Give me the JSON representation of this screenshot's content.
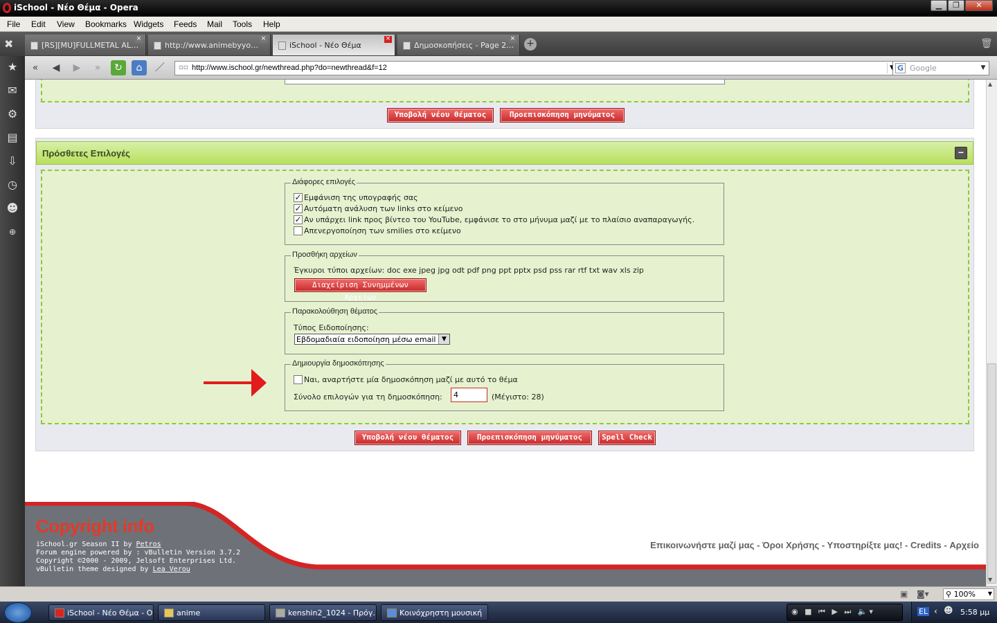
{
  "window": {
    "title": "iSchool - Νέο Θέμα - Opera",
    "controls": [
      "minimize-icon",
      "restore-icon",
      "close-icon"
    ]
  },
  "menu": [
    "File",
    "Edit",
    "View",
    "Bookmarks",
    "Widgets",
    "Feeds",
    "Mail",
    "Tools",
    "Help"
  ],
  "tabs": [
    {
      "label": "[RS][MU]FULLMETAL AL…",
      "active": false
    },
    {
      "label": "http://www.animebyyo…",
      "active": false
    },
    {
      "label": "iSchool - Νέο Θέμα",
      "active": true
    },
    {
      "label": "Δημοσκοπήσεις - Page 2…",
      "active": false
    }
  ],
  "address": {
    "url": "http://www.ischool.gr/newthread.php?do=newthread&f=12",
    "search_placeholder": "Google"
  },
  "page": {
    "top_buttons": {
      "submit": "Υποβολή νέου θέματος",
      "preview": "Προεπισκόπηση μηνύματος"
    },
    "section_title": "Πρόσθετες Επιλογές",
    "misc": {
      "legend": "Διάφορες επιλογές",
      "options": [
        {
          "label": "Εμφάνιση της υπογραφής σας",
          "checked": true
        },
        {
          "label": "Αυτόματη ανάλυση των links στο κείμενο",
          "checked": true
        },
        {
          "label": "Αν υπάρχει link προς βίντεο του YouTube, εμφάνισε το στο μήνυμα μαζί με το πλαίσιο αναπαραγωγής.",
          "checked": true
        },
        {
          "label": "Απενεργοποίηση των smilies στο κείμενο",
          "checked": false
        }
      ]
    },
    "attachments": {
      "legend": "Προσθήκη αρχείων",
      "valid_types": "Έγκυροι τύποι αρχείων: doc exe jpeg jpg odt pdf png ppt pptx psd pss rar rtf txt wav xls zip",
      "manage_button": "Διαχείριση Συνημμένων Αρχείων"
    },
    "subscription": {
      "legend": "Παρακολούθηση θέματος",
      "label": "Τύπος Ειδοποίησης:",
      "selected": "Εβδομαδιαία ειδοποίηση μέσω email"
    },
    "poll": {
      "legend": "Δημιουργία δημοσκόπησης",
      "checkbox_label": "Ναι, αναρτήστε μία δημοσκόπηση μαζί με αυτό το θέμα",
      "checked": false,
      "count_label": "Σύνολο επιλογών για τη δημοσκόπηση:",
      "count_value": "4",
      "max_label": "(Μέγιστο: 28)"
    },
    "bottom_buttons": {
      "submit": "Υποβολή νέου θέματος",
      "preview": "Προεπισκόπηση μηνύματος",
      "spell": "Spell Check"
    }
  },
  "footer": {
    "title": "Copyright info",
    "line1_prefix": "iSchool.gr Season II by ",
    "line1_link": "Petros",
    "line2": "Forum engine powered by : vBulletin Version 3.7.2",
    "line3": "Copyright ©2000 - 2009, Jelsoft Enterprises Ltd.",
    "line4_prefix": "vBulletin theme designed by ",
    "line4_link": "Lea Verou",
    "links": [
      "Επικοινωνήστε μαζί μας",
      "Όροι Χρήσης",
      "Υποστηρίξτε μας!",
      "Credits",
      "Αρχείο"
    ],
    "separator": " - "
  },
  "status": {
    "zoom": "100%"
  },
  "taskbar": {
    "items": [
      "iSchool - Νέο Θέμα - O…",
      "anime",
      "kenshin2_1024 - Πρόγ…",
      "Κοινόχρηστη μουσική"
    ],
    "lang": "EL",
    "time": "5:58 μμ"
  },
  "colors": {
    "accent_red": "#d32f2f",
    "section_green": "#b7df5c",
    "dashed_green": "#8ccc2e",
    "panel_bg": "#e6f2cf"
  }
}
